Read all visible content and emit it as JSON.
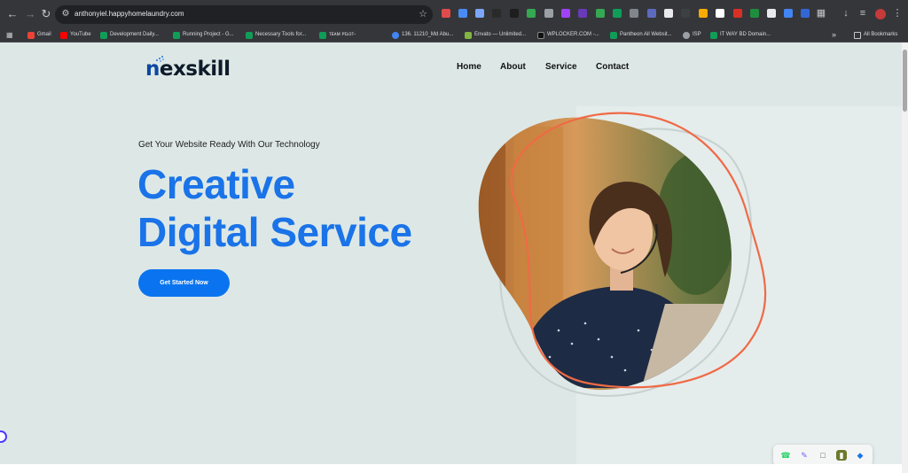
{
  "browser": {
    "url": "anthonyiel.happyhomelaundry.com",
    "all_bookmarks_label": "All Bookmarks",
    "bookmarks": [
      {
        "label": "Gmail",
        "color": "#ea4335"
      },
      {
        "label": "YouTube",
        "color": "#ff0000"
      },
      {
        "label": "Development Daily...",
        "color": "#0f9d58"
      },
      {
        "label": "Running Project - G...",
        "color": "#0f9d58"
      },
      {
        "label": "Necessary Tools for...",
        "color": "#0f9d58"
      },
      {
        "label": "ᴛᴇᴀᴍ ᴘɪʟᴏᴛ-",
        "color": "#0f9d58"
      },
      {
        "label": "136. 11210_Md Abu...",
        "color": "#4285f4"
      },
      {
        "label": "Envato — Unlimited...",
        "color": "#82b541"
      },
      {
        "label": "WPLOCKER.COM -...",
        "color": "#111111"
      },
      {
        "label": "Pantheon All Websit...",
        "color": "#0f9d58"
      },
      {
        "label": "ISP",
        "color": "#9aa0a6"
      },
      {
        "label": "IT WAY BD Domain...",
        "color": "#0f9d58"
      }
    ]
  },
  "site": {
    "logo_text": "exskill",
    "logo_initial": "n",
    "nav": [
      "Home",
      "About",
      "Service",
      "Contact"
    ],
    "eyebrow": "Get Your Website Ready With Our Technology",
    "headline_line1": "Creative",
    "headline_line2": "Digital Service",
    "cta_label": "Get Started Now",
    "colors": {
      "accent": "#1a73e8",
      "button": "#0a74f0",
      "orange_outline": "#ef6a45",
      "background": "#dde8e6"
    }
  },
  "icons": {
    "floating_bar": [
      "whatsapp-icon",
      "pen-icon",
      "chat-icon",
      "book-icon",
      "shield-icon"
    ]
  }
}
